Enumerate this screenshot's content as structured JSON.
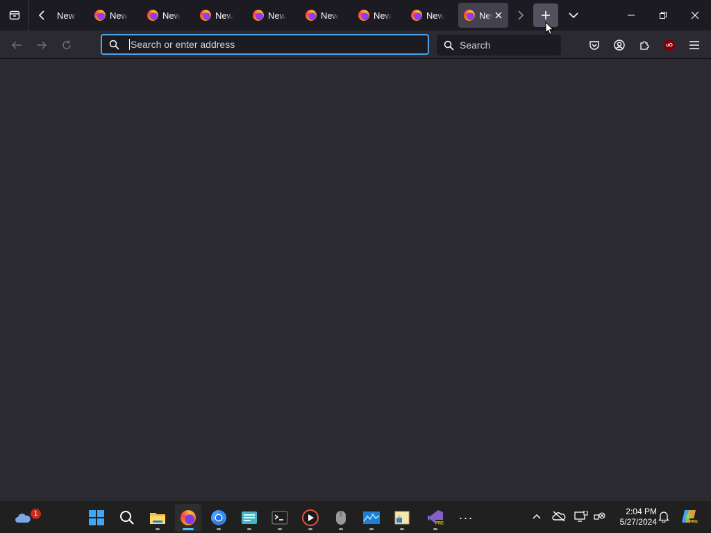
{
  "browser": {
    "tabs": [
      {
        "title": "New Tab",
        "active": false
      },
      {
        "title": "New Tab",
        "active": false
      },
      {
        "title": "New Tab",
        "active": false
      },
      {
        "title": "New Tab",
        "active": false
      },
      {
        "title": "New Tab",
        "active": false
      },
      {
        "title": "New Tab",
        "active": false
      },
      {
        "title": "New Tab",
        "active": false
      },
      {
        "title": "New Tab",
        "active": false
      },
      {
        "title": "New Tab",
        "active": true
      }
    ],
    "first_tab_title": "New Tab",
    "tab_title": "New Tab",
    "active_tab_title": "New Tab",
    "url_placeholder": "Search or enter address",
    "url_value": "",
    "search_placeholder": "Search",
    "ublock_label": "uO",
    "accent_color": "#4ea6e8",
    "content_background": "#2b2a33"
  },
  "taskbar": {
    "widgets_badge": "1",
    "clock_time": "2:04 PM",
    "clock_date": "5/27/2024",
    "overflow_label": "···",
    "pinned_apps": [
      "start-icon",
      "search-icon",
      "file-explorer-icon",
      "firefox-icon",
      "chrome-icon",
      "notepad-icon",
      "terminal-icon",
      "media-player-icon",
      "mouse-icon",
      "photos-icon",
      "paint-icon",
      "visual-studio-preview-icon"
    ]
  }
}
